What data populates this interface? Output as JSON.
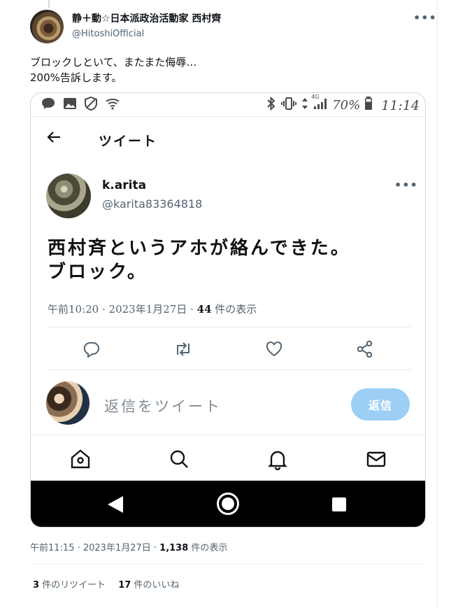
{
  "tweet": {
    "author_name": "静＋動☆日本派政治活動家 西村齊",
    "author_handle": "@HitoshiOfficial",
    "more_icon": "more-icon",
    "text": "ブロックしといて、またまた侮辱…\n200%告訴します。",
    "meta": {
      "time": "午前11:15 · 2023年1月27日 · ",
      "views": "1,138",
      "views_label": " 件の表示"
    },
    "stats": {
      "retweets": "3",
      "retweets_label": " 件のリツイート",
      "likes": "17",
      "likes_label": " 件のいいね"
    }
  },
  "screenshot": {
    "status_bar": {
      "battery": "70%",
      "time": "11:14",
      "network": "4G"
    },
    "header": {
      "title": "ツイート"
    },
    "inner_tweet": {
      "name": "k.arita",
      "handle": "@karita83364818",
      "text": "西村斉というアホが絡んできた。\nブロック。",
      "meta_time": "午前10:20 · 2023年1月27日 · ",
      "views": "44",
      "views_label": " 件の表示"
    },
    "reply": {
      "placeholder": "返信をツイート",
      "button": "返信"
    }
  },
  "colors": {
    "accent": "#1d9bf0",
    "reply_button_disabled": "#9dcff6",
    "secondary_text": "#536471",
    "nav_bar": "#000000"
  }
}
